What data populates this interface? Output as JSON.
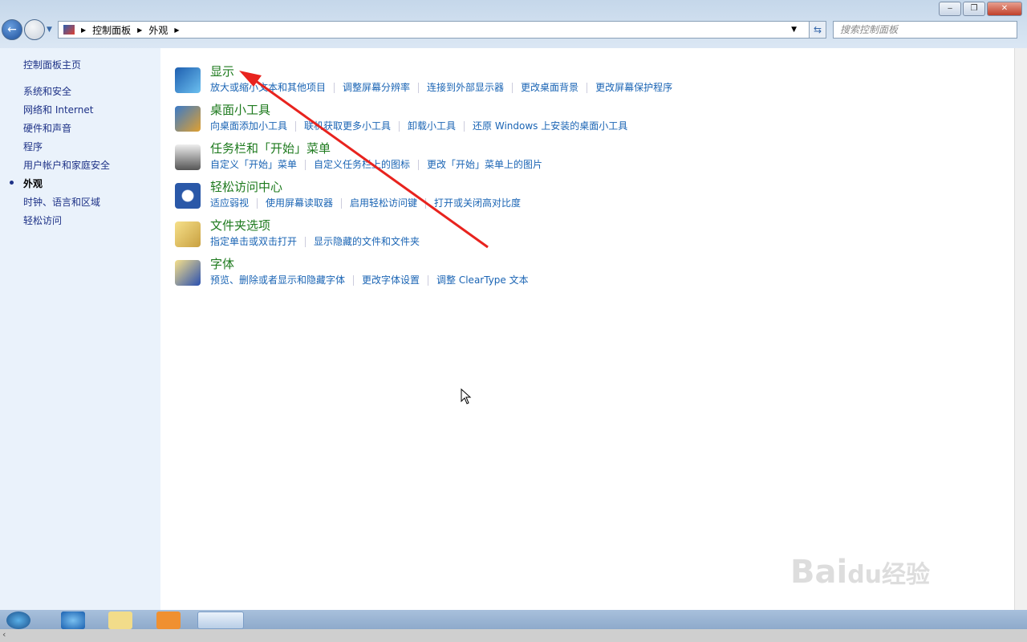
{
  "window": {
    "minimize": "‒",
    "maximize": "❐",
    "close": "✕"
  },
  "address": {
    "crumbs": [
      "控制面板",
      "外观"
    ],
    "search_placeholder": "搜索控制面板"
  },
  "sidebar": {
    "items": [
      {
        "label": "控制面板主页",
        "current": false
      },
      {
        "label": "系统和安全",
        "current": false
      },
      {
        "label": "网络和 Internet",
        "current": false
      },
      {
        "label": "硬件和声音",
        "current": false
      },
      {
        "label": "程序",
        "current": false
      },
      {
        "label": "用户帐户和家庭安全",
        "current": false
      },
      {
        "label": "外观",
        "current": true
      },
      {
        "label": "时钟、语言和区域",
        "current": false
      },
      {
        "label": "轻松访问",
        "current": false
      }
    ]
  },
  "sections": [
    {
      "title": "显示",
      "icon": "monitor-icon",
      "links": [
        "放大或缩小文本和其他项目",
        "调整屏幕分辨率",
        "连接到外部显示器",
        "更改桌面背景",
        "更改屏幕保护程序"
      ]
    },
    {
      "title": "桌面小工具",
      "icon": "gadgets-icon",
      "links": [
        "向桌面添加小工具",
        "联机获取更多小工具",
        "卸载小工具",
        "还原 Windows 上安装的桌面小工具"
      ]
    },
    {
      "title": "任务栏和「开始」菜单",
      "icon": "taskbar-icon",
      "links": [
        "自定义「开始」菜单",
        "自定义任务栏上的图标",
        "更改「开始」菜单上的图片"
      ]
    },
    {
      "title": "轻松访问中心",
      "icon": "ease-of-access-icon",
      "links": [
        "适应弱视",
        "使用屏幕读取器",
        "启用轻松访问键",
        "打开或关闭高对比度"
      ]
    },
    {
      "title": "文件夹选项",
      "icon": "folder-options-icon",
      "links": [
        "指定单击或双击打开",
        "显示隐藏的文件和文件夹"
      ]
    },
    {
      "title": "字体",
      "icon": "fonts-icon",
      "links": [
        "预览、删除或者显示和隐藏字体",
        "更改字体设置",
        "调整 ClearType 文本"
      ]
    }
  ],
  "colors": {
    "link": "#1a64b4",
    "title": "#1e7a1e",
    "annotation_arrow": "#e8231e"
  },
  "watermark": "Baidu经验 jingyan.baidu.com"
}
